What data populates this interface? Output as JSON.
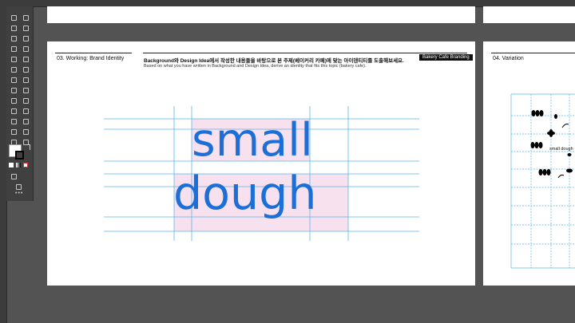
{
  "section_left": {
    "title": "03. Working: Brand Identity"
  },
  "brief": {
    "korean": "Background와 Design Idea에서 작성한 내용들을 바탕으로 본 주제(베이커리 카페)에 맞는 아이덴티티를 도출해보세요.",
    "english": "Based on what you have written in Background and Design Idea, derive an identity that fits this topic (bakery cafe).",
    "tag": "Bakery Cafe Branding"
  },
  "logo": {
    "line1": "small",
    "line2": "dough"
  },
  "section_right": {
    "title": "04. Variation",
    "mini_text": "small dough"
  },
  "colors": {
    "canvas": "#535353",
    "accent": "#1c6fd6",
    "guide": "#5ab4e6",
    "highlight": "#f8e1ef"
  }
}
